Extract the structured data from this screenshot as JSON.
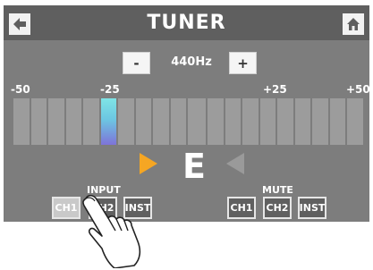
{
  "header": {
    "title": "TUNER",
    "back_icon": "arrow-left-icon",
    "home_icon": "home-icon"
  },
  "reference": {
    "minus_label": "-",
    "plus_label": "+",
    "value": "440Hz"
  },
  "scale": {
    "ticks": [
      "-50",
      "-25",
      "+25",
      "+50"
    ]
  },
  "meter": {
    "segment_count": 20,
    "active_segment_index": 5
  },
  "display": {
    "note": "E",
    "flat_arrow_color": "#f5a623",
    "sharp_arrow_color": "#9a9a9a"
  },
  "input": {
    "label": "INPUT",
    "buttons": [
      "CH1",
      "CH2",
      "INST"
    ],
    "selected": "CH1"
  },
  "mute": {
    "label": "MUTE",
    "buttons": [
      "CH1",
      "CH2",
      "INST"
    ]
  },
  "colors": {
    "screen_bg": "#7d7d7d",
    "header_bg": "#5f5f5f",
    "active_segment": "#7fc8e4"
  }
}
